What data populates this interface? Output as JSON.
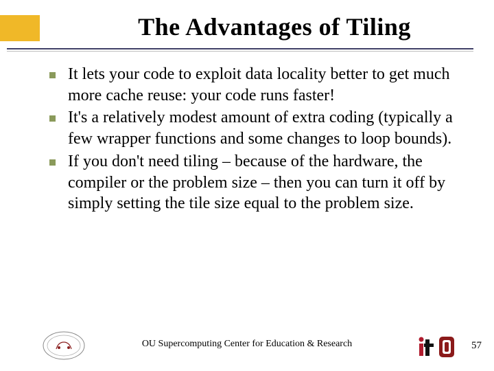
{
  "title": "The Advantages of Tiling",
  "bullets": [
    "It lets your code to exploit data locality better to get much more cache reuse: your code runs faster!",
    "It's a relatively modest amount of extra coding (typically a few wrapper functions and some changes to loop bounds).",
    "If you don't need tiling – because of the hardware, the compiler or the problem size – then you can turn it off by simply setting the tile size equal to the problem size."
  ],
  "footer": {
    "text": "OU Supercomputing Center for Education & Research",
    "page": "57"
  }
}
